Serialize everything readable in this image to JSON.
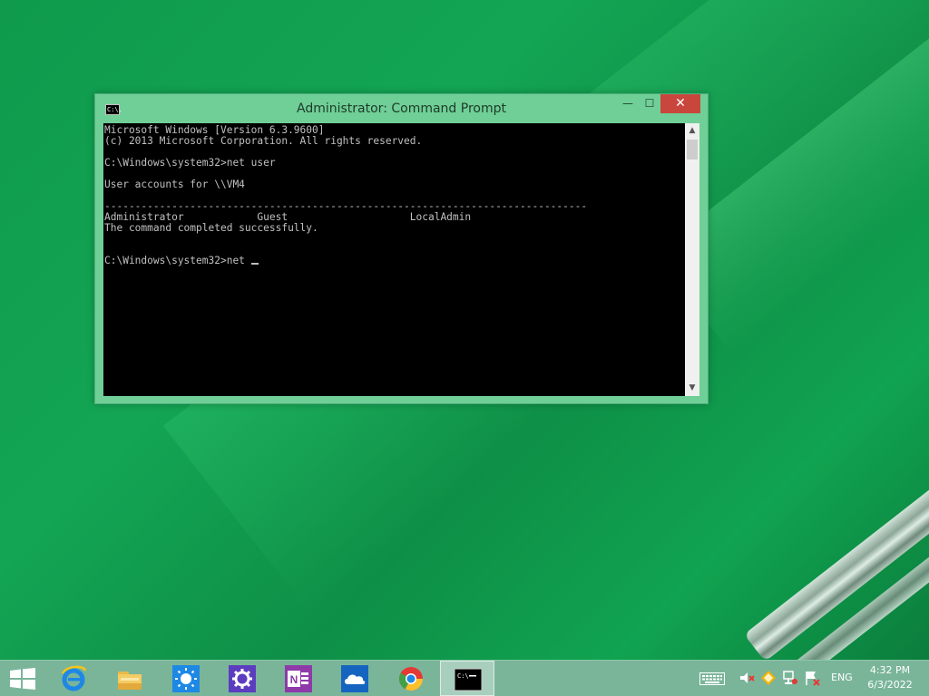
{
  "window": {
    "title": "Administrator: Command Prompt",
    "icon_text": "C:\\.",
    "min_glyph": "—",
    "max_glyph": "☐",
    "close_glyph": "✕"
  },
  "console": {
    "lines": [
      "Microsoft Windows [Version 6.3.9600]",
      "(c) 2013 Microsoft Corporation. All rights reserved.",
      "",
      "C:\\Windows\\system32>net user",
      "",
      "User accounts for \\\\VM4",
      "",
      "-------------------------------------------------------------------------------",
      "Administrator            Guest                    LocalAdmin",
      "The command completed successfully.",
      "",
      "",
      "C:\\Windows\\system32>net "
    ]
  },
  "scrollbar": {
    "up_glyph": "▲",
    "down_glyph": "▼"
  },
  "taskbar": {
    "apps": [
      {
        "name": "start-button",
        "icon": "windows-logo-icon"
      },
      {
        "name": "internet-explorer",
        "icon": "internet-explorer-icon"
      },
      {
        "name": "file-explorer",
        "icon": "folder-icon"
      },
      {
        "name": "weather",
        "icon": "sun-icon"
      },
      {
        "name": "settings",
        "icon": "gear-icon"
      },
      {
        "name": "onenote",
        "icon": "onenote-icon"
      },
      {
        "name": "onedrive",
        "icon": "cloud-icon"
      },
      {
        "name": "chrome",
        "icon": "chrome-icon"
      },
      {
        "name": "command-prompt",
        "icon": "console-icon",
        "active": true
      }
    ],
    "tray": {
      "language": "ENG",
      "time": "4:32 PM",
      "date": "6/3/2022"
    }
  },
  "colors": {
    "accent": "#6fcf97",
    "close": "#c9463d",
    "console_bg": "#000000",
    "console_fg": "#c0c0c0",
    "taskbar": "#7ab59a"
  }
}
